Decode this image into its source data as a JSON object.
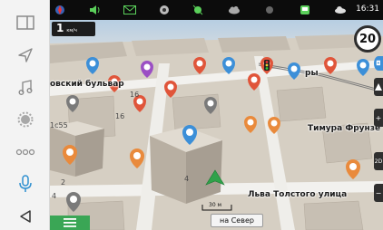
{
  "statusbar": {
    "time": "16:31",
    "icons": [
      "compass-icon",
      "volume-icon",
      "message-icon",
      "navigation-pin-icon",
      "satellite-icon",
      "cloud-icon",
      "record-icon",
      "bus-stop-icon",
      "weather-icon"
    ]
  },
  "leftbar": {
    "icons": [
      "split-screen-icon",
      "navigation-arrow-icon",
      "music-icon",
      "settings-icon",
      "more-dots-icon",
      "microphone-icon",
      "back-icon"
    ]
  },
  "nav": {
    "speed_value": "1",
    "speed_unit": "км/ч",
    "speed_limit": "20",
    "north_button": "на Север",
    "scale_label": "30 м",
    "right_labels": [
      "2D"
    ]
  },
  "map": {
    "streets": [
      {
        "text": "овский бульвар"
      },
      {
        "text": "Тимура Фрунзе улица"
      },
      {
        "text": "Льва Толстого улица"
      },
      {
        "text": "ры"
      }
    ],
    "building_numbers": [
      "1c55",
      "16",
      "16",
      "4",
      "2",
      "4"
    ]
  },
  "colors": {
    "accent_green": "#3aa655",
    "statusbar_bg": "#0c0c0c",
    "poi_red": "#e0553a",
    "poi_orange": "#e98a3c",
    "poi_blue": "#3c8fd8"
  }
}
